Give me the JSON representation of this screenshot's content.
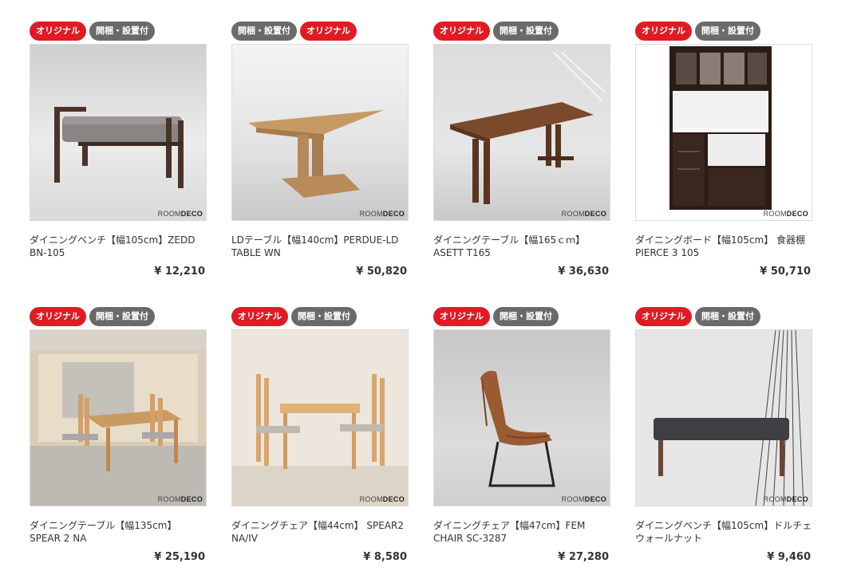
{
  "products": [
    {
      "badges": [
        {
          "label": "オリジナル",
          "color": "#e01b24"
        },
        {
          "label": "開梱・設置付",
          "color": "#6a6a6a"
        }
      ],
      "name": "ダイニングベンチ【幅105cm】ZEDD BN-105",
      "price": "¥ 12,210",
      "image_icon": "dining-bench-image"
    },
    {
      "badges": [
        {
          "label": "開梱・設置付",
          "color": "#6a6a6a"
        },
        {
          "label": "オリジナル",
          "color": "#e01b24"
        }
      ],
      "name": "LDテーブル【幅140cm】PERDUE-LD TABLE WN",
      "price": "¥ 50,820",
      "image_icon": "ld-table-image"
    },
    {
      "badges": [
        {
          "label": "オリジナル",
          "color": "#e01b24"
        },
        {
          "label": "開梱・設置付",
          "color": "#6a6a6a"
        }
      ],
      "name": "ダイニングテーブル【幅165ｃｍ】ASETT T165",
      "price": "¥ 36,630",
      "image_icon": "dining-table-image"
    },
    {
      "badges": [
        {
          "label": "オリジナル",
          "color": "#e01b24"
        },
        {
          "label": "開梱・設置付",
          "color": "#6a6a6a"
        }
      ],
      "name": "ダイニングボード【幅105cm】 食器棚PIERCE 3 105",
      "price": "¥ 50,710",
      "image_icon": "cupboard-image"
    },
    {
      "badges": [
        {
          "label": "オリジナル",
          "color": "#e01b24"
        },
        {
          "label": "開梱・設置付",
          "color": "#6a6a6a"
        }
      ],
      "name": "ダイニングテーブル【幅135cm】SPEAR 2 NA",
      "price": "¥ 25,190",
      "image_icon": "dining-set-image"
    },
    {
      "badges": [
        {
          "label": "オリジナル",
          "color": "#e01b24"
        },
        {
          "label": "開梱・設置付",
          "color": "#6a6a6a"
        }
      ],
      "name": "ダイニングチェア【幅44cm】 SPEAR2 NA/IV",
      "price": "¥ 8,580",
      "image_icon": "dining-chair-set-image"
    },
    {
      "badges": [
        {
          "label": "オリジナル",
          "color": "#e01b24"
        },
        {
          "label": "開梱・設置付",
          "color": "#6a6a6a"
        }
      ],
      "name": "ダイニングチェア【幅47cm】FEM CHAIR SC-3287",
      "price": "¥ 27,280",
      "image_icon": "leather-chair-image"
    },
    {
      "badges": [
        {
          "label": "オリジナル",
          "color": "#e01b24"
        },
        {
          "label": "開梱・設置付",
          "color": "#6a6a6a"
        }
      ],
      "name": "ダイニングベンチ【幅105cm】ドルチェウォールナット",
      "price": "¥ 9,460",
      "image_icon": "walnut-bench-image"
    }
  ],
  "logo": {
    "room": "R",
    "o1": "O",
    "o2": "O",
    "m": "M",
    "deco": "DECO"
  }
}
